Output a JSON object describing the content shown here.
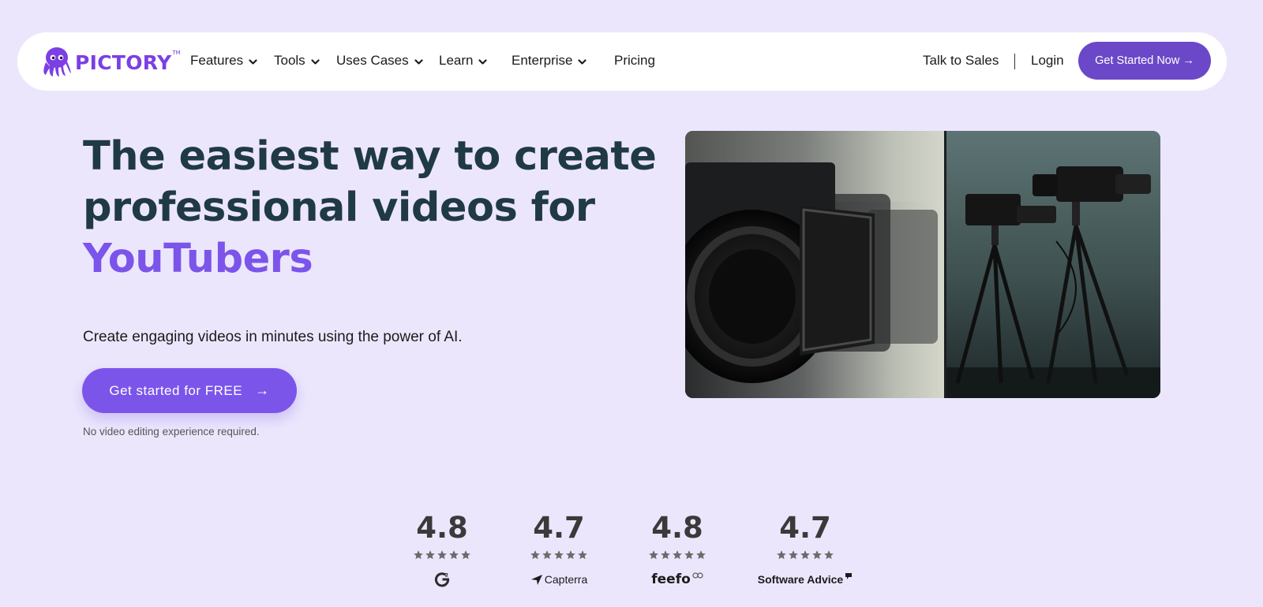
{
  "brand": {
    "name": "PICTORY",
    "trademark": "TM",
    "color": "#7b3fe4"
  },
  "nav": {
    "items": [
      {
        "label": "Features",
        "dropdown": true
      },
      {
        "label": "Tools",
        "dropdown": true
      },
      {
        "label": "Uses Cases",
        "dropdown": true
      },
      {
        "label": "Learn",
        "dropdown": true
      },
      {
        "label": "Enterprise",
        "dropdown": true
      },
      {
        "label": "Pricing",
        "dropdown": false
      }
    ],
    "talk_to_sales": "Talk to Sales",
    "login": "Login",
    "cta": "Get Started Now",
    "cta_arrow": "→"
  },
  "hero": {
    "title_line1": "The easiest way to create",
    "title_line2": "professional videos for",
    "title_accent": "YouTubers",
    "subtitle": "Create engaging videos in minutes using the power of AI.",
    "cta": "Get started for FREE",
    "cta_arrow": "→",
    "note": "No video editing experience required."
  },
  "ratings": [
    {
      "value": "4.8",
      "stars": 5,
      "source": "G2",
      "source_icon": "g2-logo-icon"
    },
    {
      "value": "4.7",
      "stars": 5,
      "source": "Capterra",
      "source_icon": "capterra-logo-icon"
    },
    {
      "value": "4.8",
      "stars": 5,
      "source": "feefo",
      "source_icon": "feefo-logo-icon"
    },
    {
      "value": "4.7",
      "stars": 5,
      "source": "Software Advice",
      "source_icon": "software-advice-logo-icon"
    }
  ],
  "colors": {
    "background": "#ece6fd",
    "accent": "#7b55ea",
    "nav_cta": "#6b48c7",
    "heading": "#1f3a45"
  }
}
